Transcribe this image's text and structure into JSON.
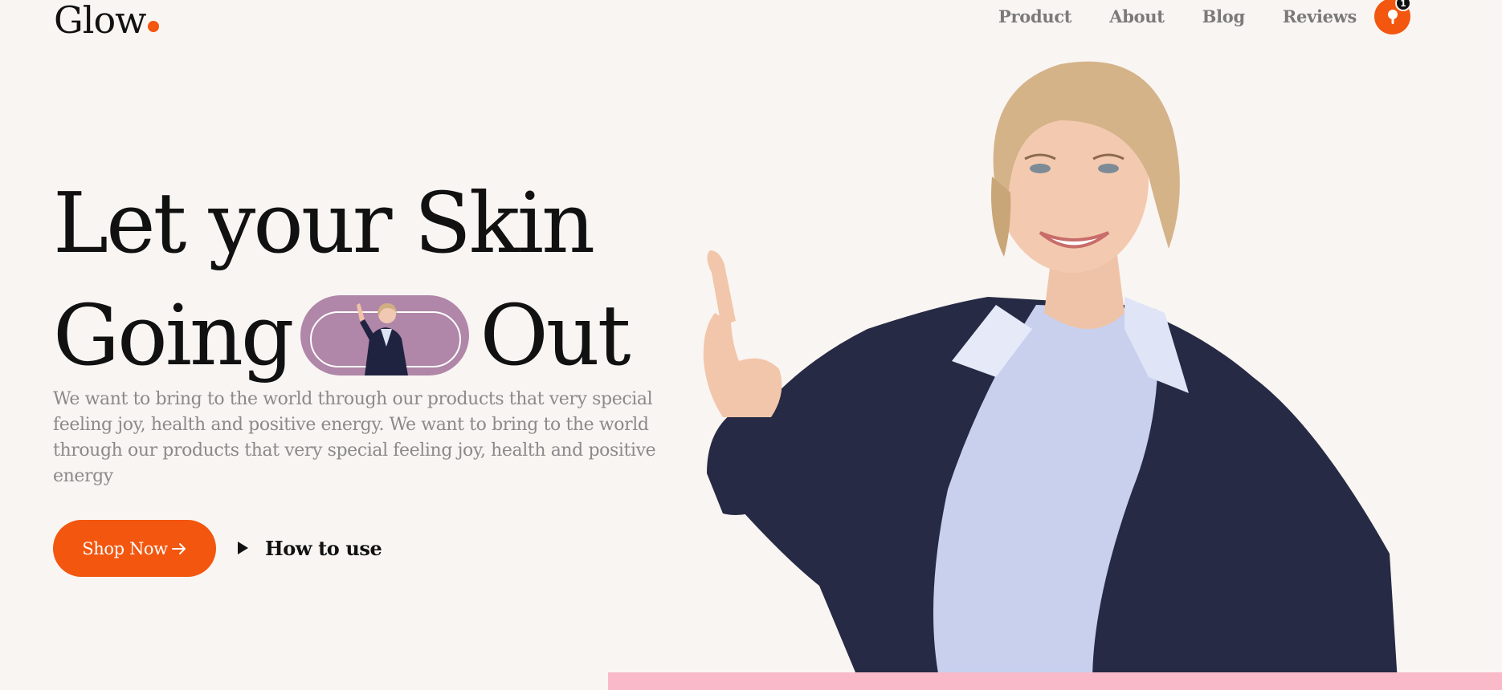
{
  "brand": {
    "name": "Glow",
    "accent": "#f2560f"
  },
  "nav": {
    "items": [
      {
        "label": "Product"
      },
      {
        "label": "About"
      },
      {
        "label": "Blog"
      },
      {
        "label": "Reviews"
      }
    ],
    "cart_count": "1",
    "cart_icon": "shopping-bag-icon"
  },
  "hero": {
    "headline_line1": "Let your Skin",
    "headline_word_a": "Going",
    "headline_word_b": "Out",
    "description": "We want to bring to the world through our products that very special feeling joy, health and positive energy. We want to bring to the world through our products that very special feeling joy, health and positive energy",
    "primary_button": "Shop Now",
    "primary_button_icon": "arrow-right-icon",
    "secondary_button": "How to use",
    "secondary_button_icon": "play-icon",
    "pill_color": "#b087a8",
    "band_color": "#f9b9c9"
  }
}
